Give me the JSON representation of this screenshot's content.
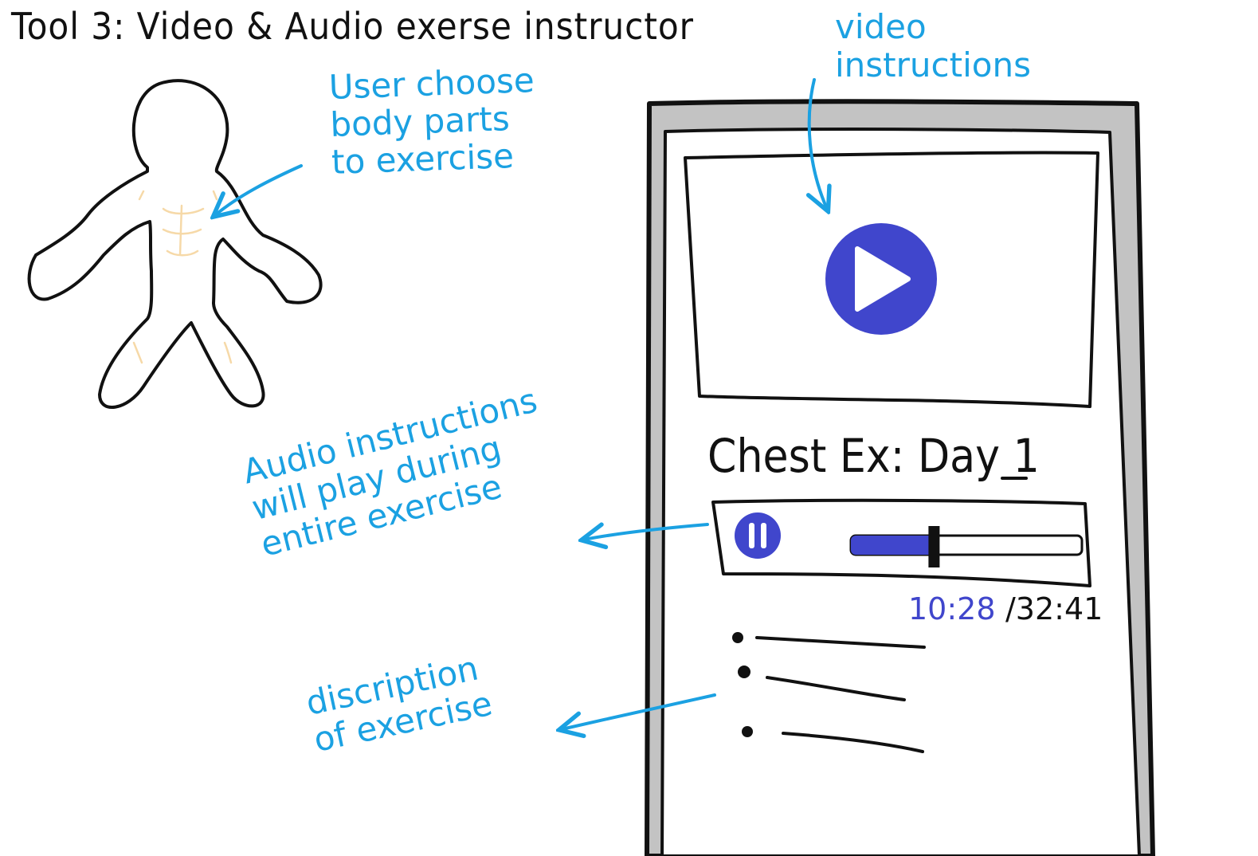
{
  "title": "Tool 3: Video & Audio exerse instructor",
  "annotations": {
    "body_parts": "User choose\nbody parts\nto exercise",
    "video": "video\ninstructions",
    "audio": "Audio instructions\nwill play during\nentire exercise",
    "description": "discription\nof exercise"
  },
  "phone": {
    "exercise_title": "Chest Ex: Day 1",
    "audio_player": {
      "current_time": "10:28",
      "total_time": "/32:41",
      "progress_fraction": 0.36
    },
    "description_items": 3
  },
  "colors": {
    "annotation": "#1ba1e2",
    "accent": "#4046cc",
    "phone_frame": "#c3c3c3",
    "muscle_hint": "#f6d9a8"
  }
}
